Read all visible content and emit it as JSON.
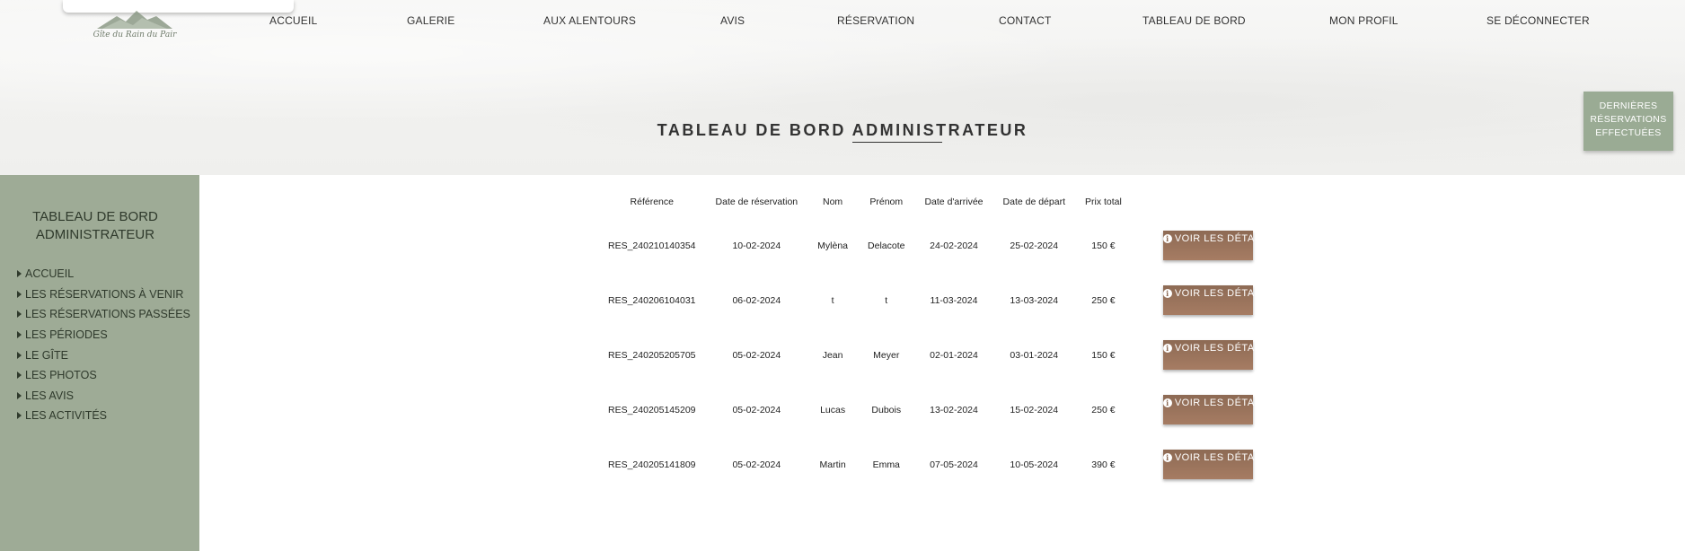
{
  "logo": {
    "text": "Gîte du Rain du Pair"
  },
  "nav": {
    "items": [
      {
        "label": "ACCUEIL"
      },
      {
        "label": "GALERIE"
      },
      {
        "label": "AUX ALENTOURS"
      },
      {
        "label": "AVIS"
      },
      {
        "label": "RÉSERVATION"
      },
      {
        "label": "CONTACT"
      },
      {
        "label": "TABLEAU DE BORD"
      },
      {
        "label": "MON PROFIL"
      },
      {
        "label": "SE DÉCONNECTER"
      }
    ]
  },
  "page": {
    "title": "TABLEAU DE BORD ADMINISTRATEUR"
  },
  "last_reservations_button": {
    "label": "DERNIÈRES RÉSERVATIONS EFFECTUÉES"
  },
  "sidebar": {
    "title": "TABLEAU DE BORD ADMINISTRATEUR",
    "items": [
      {
        "label": "ACCUEIL"
      },
      {
        "label": "LES RÉSERVATIONS À VENIR"
      },
      {
        "label": "LES RÉSERVATIONS PASSÉES"
      },
      {
        "label": "LES PÉRIODES"
      },
      {
        "label": "LE GÎTE"
      },
      {
        "label": "LES PHOTOS"
      },
      {
        "label": "LES AVIS"
      },
      {
        "label": "LES ACTIVITÉS"
      }
    ]
  },
  "table": {
    "headers": [
      "Référence",
      "Date de réservation",
      "Nom",
      "Prénom",
      "Date d'arrivée",
      "Date de départ",
      "Prix total"
    ],
    "details_label": "VOIR LES DÉTAILS",
    "rows": [
      [
        "RES_240210140354",
        "10-02-2024",
        "Mylèna",
        "Delacote",
        "24-02-2024",
        "25-02-2024",
        "150 €"
      ],
      [
        "RES_240206104031",
        "06-02-2024",
        "t",
        "t",
        "11-03-2024",
        "13-03-2024",
        "250 €"
      ],
      [
        "RES_240205205705",
        "05-02-2024",
        "Jean",
        "Meyer",
        "02-01-2024",
        "03-01-2024",
        "150 €"
      ],
      [
        "RES_240205145209",
        "05-02-2024",
        "Lucas",
        "Dubois",
        "13-02-2024",
        "15-02-2024",
        "250 €"
      ],
      [
        "RES_240205141809",
        "05-02-2024",
        "Martin",
        "Emma",
        "07-05-2024",
        "10-05-2024",
        "390 €"
      ]
    ]
  },
  "colors": {
    "sidebar": "#9eab96",
    "accent_button": "#9aab94",
    "details_button": "#a67c63"
  }
}
